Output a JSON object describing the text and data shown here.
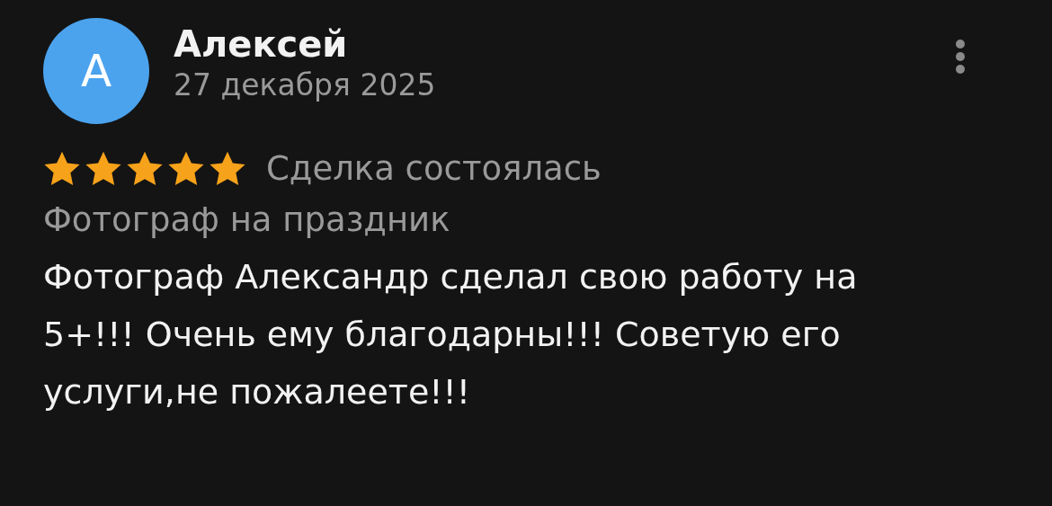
{
  "review": {
    "avatar_letter": "А",
    "author": "Алексей",
    "date": "27 декабря 2025",
    "stars": 5,
    "deal_status": "Сделка состоялась",
    "service": "Фотограф на праздник",
    "text": "Фотограф Александр сделал свою работу на 5+!!! Очень ему благодарны!!! Советую его услуги,не пожалеете!!!"
  }
}
